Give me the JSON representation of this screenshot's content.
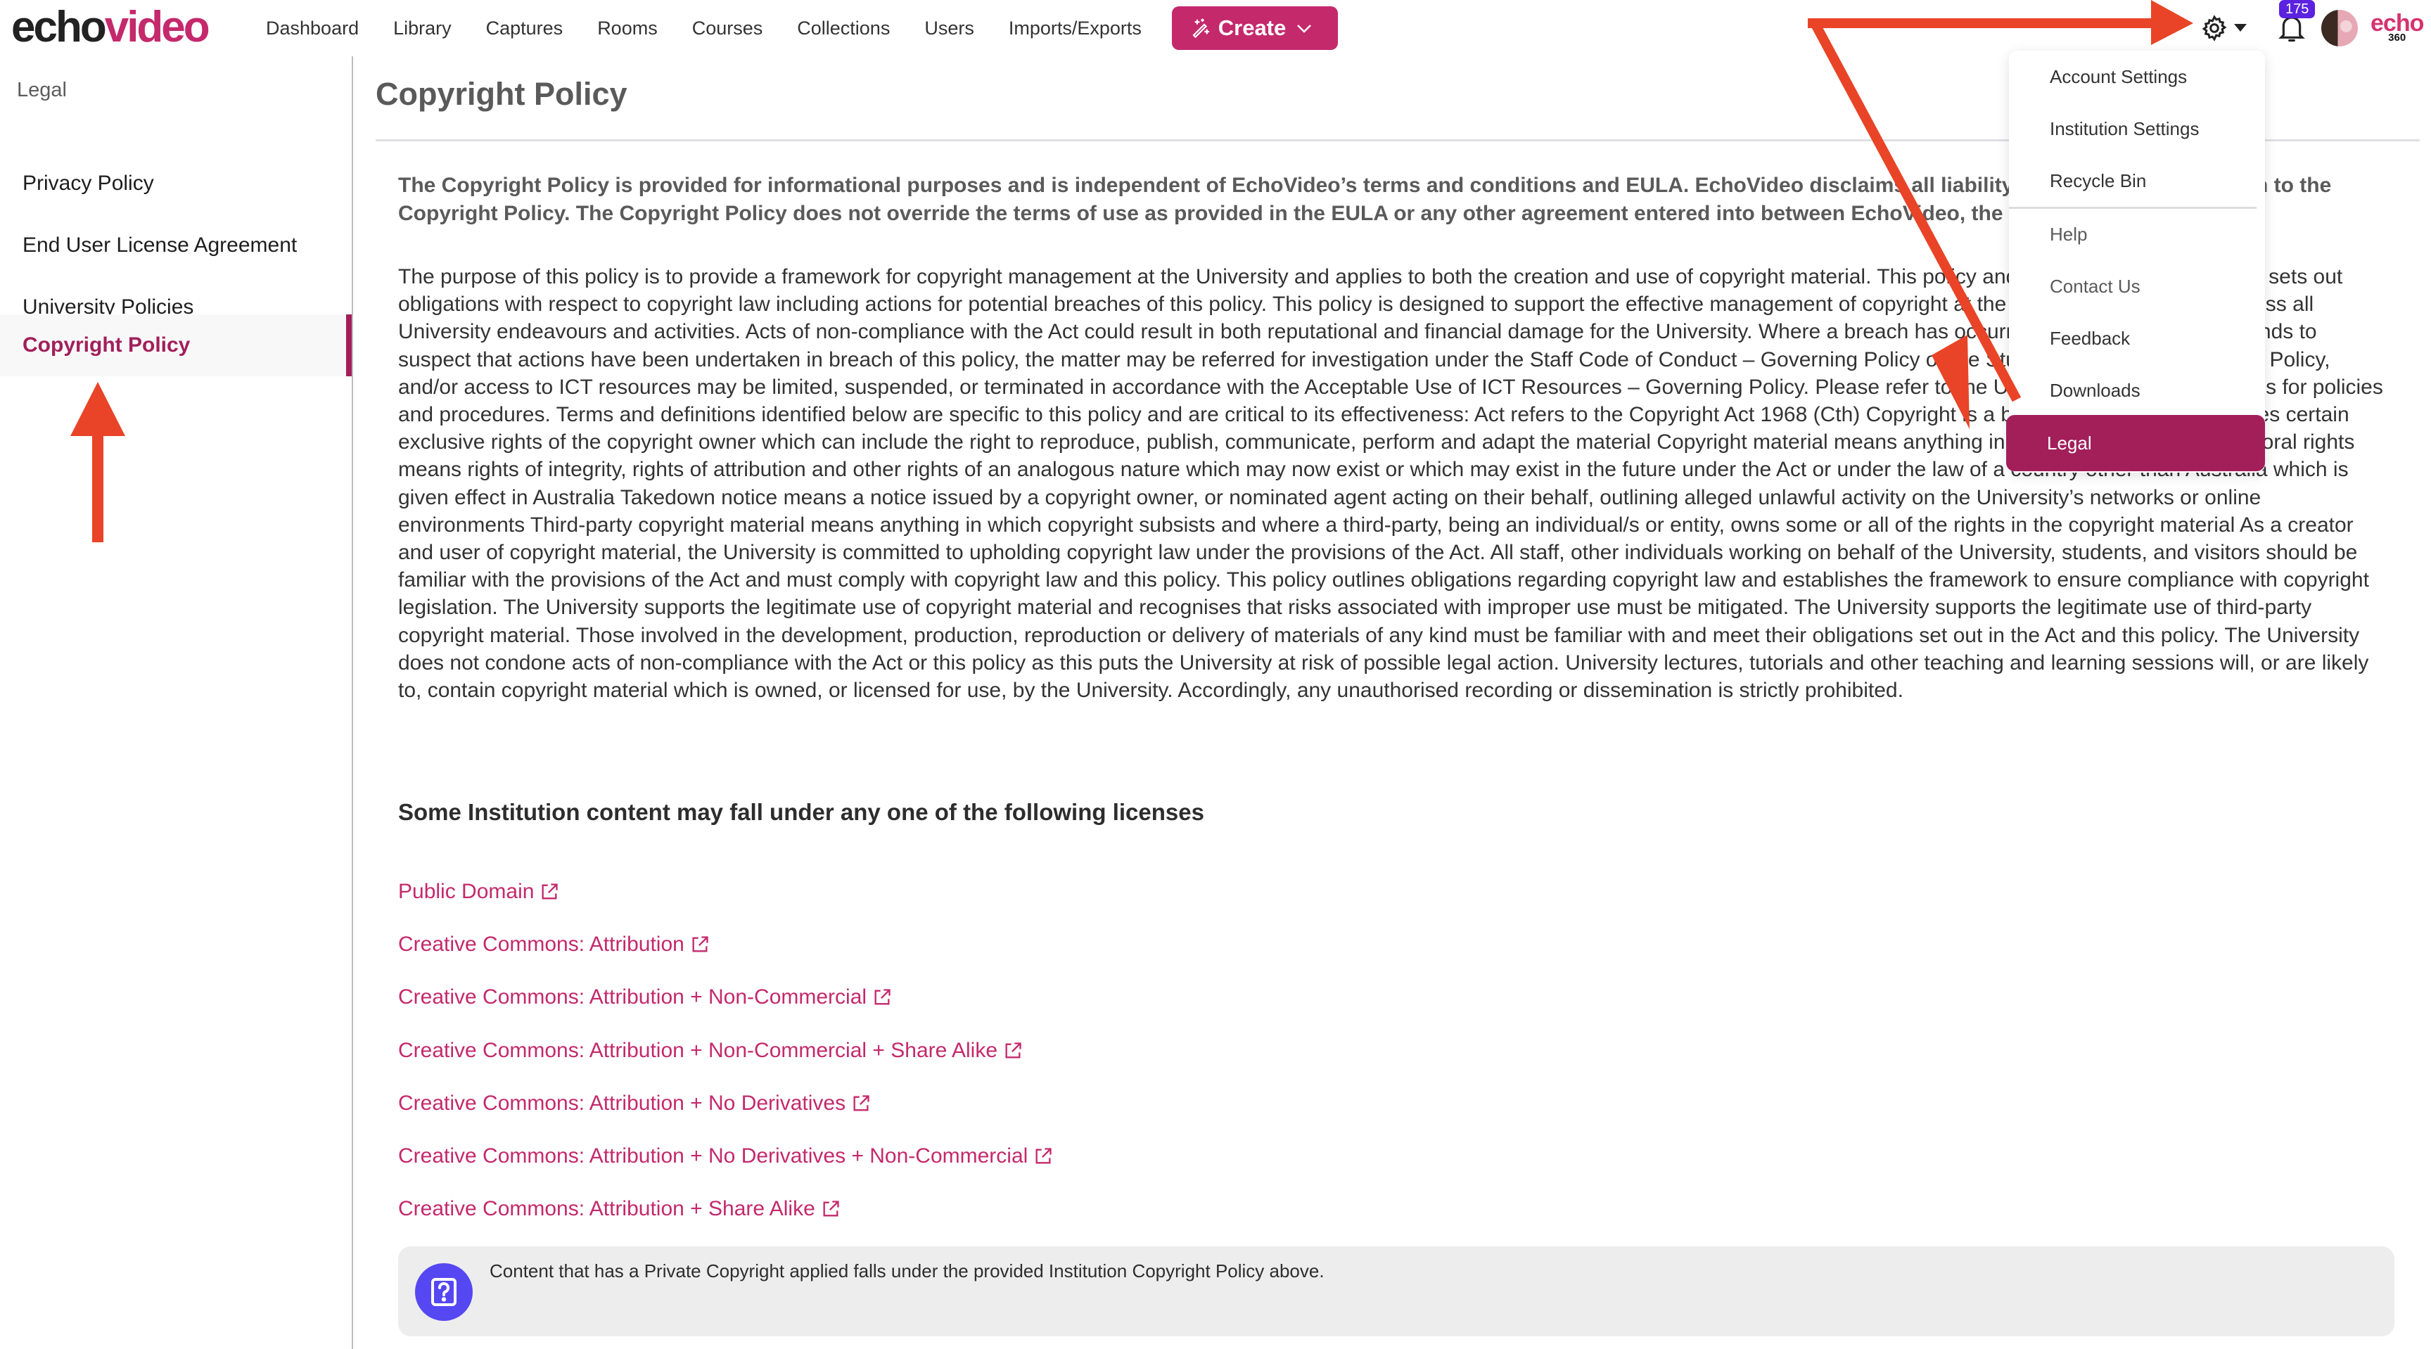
{
  "brand": {
    "logo_part1": "echo",
    "logo_part2": "video",
    "partner_logo_top": "echo",
    "partner_logo_bottom": "360"
  },
  "nav": {
    "items": [
      "Dashboard",
      "Library",
      "Captures",
      "Rooms",
      "Courses",
      "Collections",
      "Users",
      "Imports/Exports"
    ],
    "create_label": "Create"
  },
  "header_icons": {
    "settings": "gear-icon",
    "settings_caret": "caret-down-icon",
    "notifications": "bell-icon",
    "notification_count": "175",
    "avatar": "user-avatar"
  },
  "settings_menu": {
    "items": [
      {
        "label": "Account Settings",
        "group": "primary"
      },
      {
        "label": "Institution Settings",
        "group": "primary"
      },
      {
        "label": "Recycle Bin",
        "group": "primary"
      },
      {
        "label": "Help",
        "group": "secondary"
      },
      {
        "label": "Contact Us",
        "group": "secondary"
      },
      {
        "label": "Feedback",
        "group": "secondary"
      },
      {
        "label": "Downloads",
        "group": "secondary"
      },
      {
        "label": "Legal",
        "group": "secondary",
        "active": true
      }
    ]
  },
  "sidebar": {
    "heading": "Legal",
    "items": [
      {
        "label": "Privacy Policy"
      },
      {
        "label": "End User License Agreement"
      },
      {
        "label": "University Policies"
      },
      {
        "label": "Copyright Policy",
        "active": true
      }
    ]
  },
  "main": {
    "title": "Copyright Policy",
    "intro": "The Copyright Policy is provided for informational purposes and is independent of EchoVideo’s terms and conditions and EULA. EchoVideo disclaims all liability that may arise in relation to the Copyright Policy. The Copyright Policy does not override the terms of use as provided in the EULA or any other agreement entered into between EchoVideo, the Institution and the user.",
    "body": "The purpose of this policy is to provide a framework for copyright management at the University and applies to both the creation and use of copyright material. This policy and its associated procedures sets out obligations with respect to copyright law including actions for potential breaches of this policy. This policy is designed to support the effective management of copyright at the University and applies across all University endeavours and activities. Acts of non-compliance with the Act could result in both reputational and financial damage for the University. Where a breach has occurred or has reasonable grounds to suspect that actions have been undertaken in breach of this policy, the matter may be referred for investigation under the Staff Code of Conduct – Governing Policy or the Student Conduct – Governing Policy, and/or access to ICT resources may be limited, suspended, or terminated in accordance with the Acceptable Use of ICT Resources – Governing Policy. Please refer to the University’s Glossary of Terms for policies and procedures. Terms and definitions identified below are specific to this policy and are critical to its effectiveness: Act refers to the Copyright Act 1968 (Cth) Copyright is a broad term that encompasses certain exclusive rights of the copyright owner which can include the right to reproduce, publish, communicate, perform and adapt the material Copyright material means anything in which copyright subsists Moral rights means rights of integrity, rights of attribution and other rights of an analogous nature which may now exist or which may exist in the future under the Act or under the law of a country other than Australia which is given effect in Australia Takedown notice means a notice issued by a copyright owner, or nominated agent acting on their behalf, outlining alleged unlawful activity on the University’s networks or online environments Third-party copyright material means anything in which copyright subsists and where a third-party, being an individual/s or entity, owns some or all of the rights in the copyright material As a creator and user of copyright material, the University is committed to upholding copyright law under the provisions of the Act. All staff, other individuals working on behalf of the University, students, and visitors should be familiar with the provisions of the Act and must comply with copyright law and this policy. This policy outlines obligations regarding copyright law and establishes the framework to ensure compliance with copyright legislation. The University supports the legitimate use of copyright material and recognises that risks associated with improper use must be mitigated. The University supports the legitimate use of third-party copyright material. Those involved in the development, production, reproduction or delivery of materials of any kind must be familiar with and meet their obligations set out in the Act and this policy. The University does not condone acts of non-compliance with the Act or this policy as this puts the University at risk of possible legal action. University lectures, tutorials and other teaching and learning sessions will, or are likely to, contain copyright material which is owned, or licensed for use, by the University. Accordingly, any unauthorised recording or dissemination is strictly prohibited.",
    "licenses_heading": "Some Institution content may fall under any one of the following licenses",
    "licenses": [
      "Public Domain",
      "Creative Commons: Attribution",
      "Creative Commons: Attribution + Non-Commercial",
      "Creative Commons: Attribution + Non-Commercial + Share Alike",
      "Creative Commons: Attribution + No Derivatives",
      "Creative Commons: Attribution + No Derivatives + Non-Commercial",
      "Creative Commons: Attribution + Share Alike"
    ],
    "info_note": "Content that has a Private Copyright applied falls under the provided Institution Copyright Policy above."
  },
  "colors": {
    "brand_pink": "#c4296c",
    "active_maroon": "#a21f5a",
    "badge_purple": "#5b22e0",
    "info_icon_blue": "#5548f2",
    "annotation_red": "#e94427"
  }
}
